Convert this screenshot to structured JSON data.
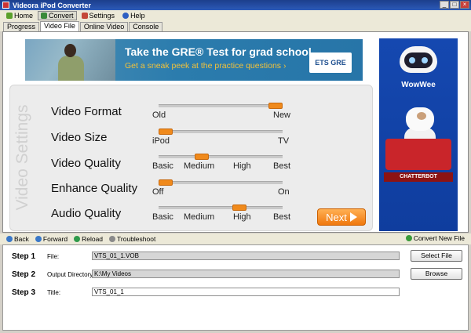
{
  "window": {
    "title": "Videora iPod Converter",
    "controls": [
      "_",
      "□",
      "×"
    ]
  },
  "menu": {
    "items": [
      {
        "label": "Home",
        "icon": "home-icon",
        "active": false
      },
      {
        "label": "Convert",
        "icon": "convert-icon",
        "active": true
      },
      {
        "label": "Settings",
        "icon": "settings-icon",
        "active": false
      },
      {
        "label": "Help",
        "icon": "help-icon",
        "active": false
      }
    ]
  },
  "tabs": [
    {
      "label": "Progress",
      "active": false
    },
    {
      "label": "Video File",
      "active": true
    },
    {
      "label": "Online Video",
      "active": false
    },
    {
      "label": "Console",
      "active": false
    }
  ],
  "ad_top": {
    "headline": "Take the GRE® Test for grad school.",
    "subline": "Get a sneak peek at the practice questions ›",
    "logo": "ETS GRE"
  },
  "ad_side": {
    "brand": "WowWee",
    "product": "CHATTERBOT"
  },
  "settings": {
    "panel_title": "Video Settings",
    "rows": [
      {
        "label": "Video Format",
        "ticks": [
          "Old",
          "New"
        ],
        "value": 1.0
      },
      {
        "label": "Video Size",
        "ticks": [
          "iPod",
          "TV"
        ],
        "value": 0.0
      },
      {
        "label": "Video Quality",
        "ticks": [
          "Basic",
          "Medium",
          "High",
          "Best"
        ],
        "value": 0.33
      },
      {
        "label": "Enhance Quality",
        "ticks": [
          "Off",
          "On"
        ],
        "value": 0.0
      },
      {
        "label": "Audio Quality",
        "ticks": [
          "Basic",
          "Medium",
          "High",
          "Best"
        ],
        "value": 0.67
      }
    ],
    "next_label": "Next",
    "accent_color": "#f08a1c"
  },
  "nav": {
    "back": "Back",
    "forward": "Forward",
    "reload": "Reload",
    "troubleshoot": "Troubleshoot",
    "convert_new": "Convert New File"
  },
  "steps": [
    {
      "step": "Step 1",
      "field_label": "File:",
      "value": "VTS_01_1.VOB",
      "button": "Select File"
    },
    {
      "step": "Step 2",
      "field_label": "Output Directory:",
      "value": "K:\\My Videos",
      "button": "Browse"
    },
    {
      "step": "Step 3",
      "field_label": "Title:",
      "value": "VTS_01_1",
      "button": ""
    }
  ]
}
